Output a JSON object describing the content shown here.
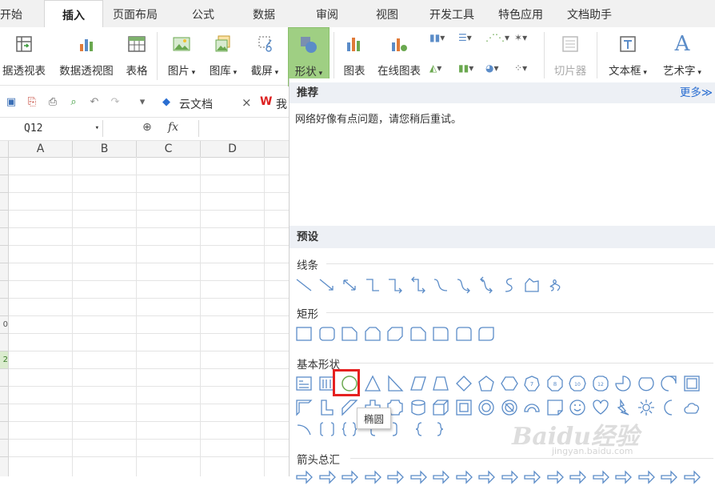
{
  "menu": {
    "tabs": [
      "开始",
      "插入",
      "页面布局",
      "公式",
      "数据",
      "审阅",
      "视图",
      "开发工具",
      "特色应用",
      "文档助手"
    ],
    "active": "插入"
  },
  "ribbon": {
    "buttons": [
      "据透视表",
      "数据透视图",
      "表格",
      "图片",
      "图库",
      "截屏",
      "形状",
      "图表",
      "在线图表",
      "切片器",
      "文本框",
      "艺术字"
    ],
    "selected": "形状"
  },
  "quickbar": {
    "doc_tab": "云文档",
    "close_glyph": "×",
    "next_tab_glyph": "W",
    "next_tab_text": "我"
  },
  "formula": {
    "namebox": "Q12",
    "fx": "fx"
  },
  "sheet": {
    "columns": [
      "A",
      "B",
      "C",
      "D"
    ],
    "row_labels": [
      "0",
      "2"
    ]
  },
  "panel": {
    "recommend_title": "推荐",
    "more_link": "更多≫",
    "network_error": "网络好像有点问题，请您稍后重试。",
    "preset_title": "预设",
    "sections": [
      "线条",
      "矩形",
      "基本形状",
      "箭头总汇"
    ],
    "tooltip": "椭圆"
  },
  "watermark": {
    "main": "Baidu经验",
    "sub": "jingyan.baidu.com"
  },
  "colors": {
    "accent_green": "#9fcf83",
    "shape_blue": "#5b8cc8",
    "highlight_red": "#e52020",
    "link_blue": "#2a6ed1"
  }
}
